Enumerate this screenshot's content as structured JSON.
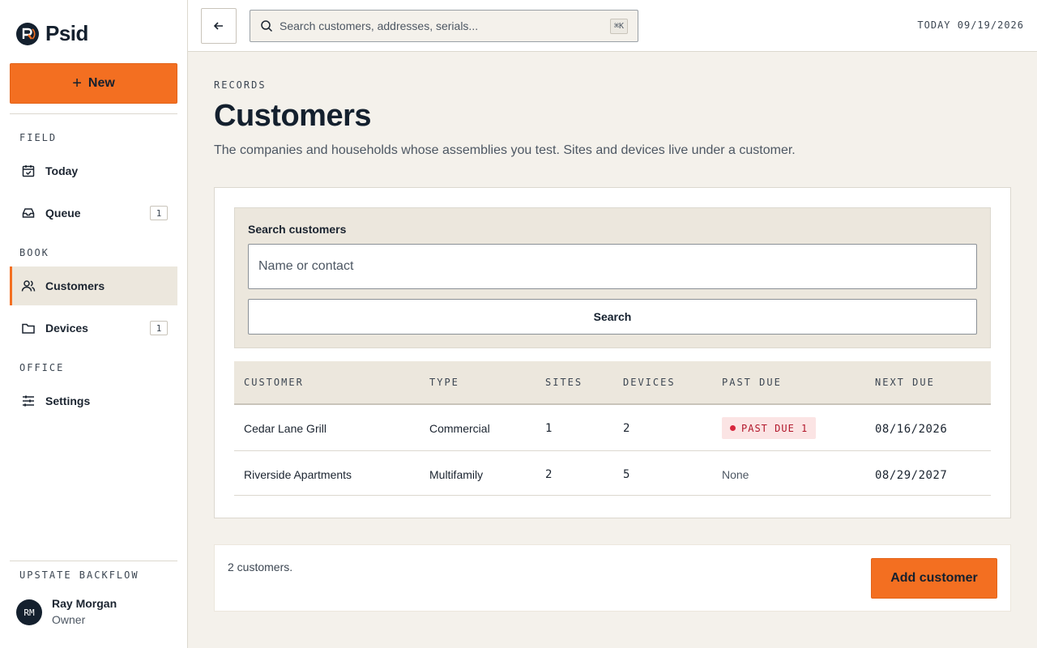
{
  "brand": {
    "name": "Psid",
    "logo_icon": "psid-logo-icon"
  },
  "sidebar": {
    "new_label": "New",
    "sections": {
      "field": "FIELD",
      "book": "BOOK",
      "office": "OFFICE"
    },
    "items": [
      {
        "label": "Today",
        "icon": "calendar-check-icon",
        "badge": null
      },
      {
        "label": "Queue",
        "icon": "inbox-icon",
        "badge": "1"
      },
      {
        "label": "Customers",
        "icon": "users-icon",
        "badge": null,
        "active": true
      },
      {
        "label": "Devices",
        "icon": "folder-icon",
        "badge": "1"
      },
      {
        "label": "Settings",
        "icon": "sliders-icon",
        "badge": null
      }
    ],
    "org": "UPSTATE BACKFLOW",
    "user": {
      "initials": "RM",
      "name": "Ray Morgan",
      "role": "Owner"
    }
  },
  "topbar": {
    "search_placeholder": "Search customers, addresses, serials...",
    "shortcut": "⌘K",
    "today": "TODAY 09/19/2026"
  },
  "main": {
    "eyebrow": "RECORDS",
    "title": "Customers",
    "subtitle": "The companies and households whose assemblies you test. Sites and devices live under a customer.",
    "search_panel": {
      "label": "Search customers",
      "placeholder": "Name or contact",
      "button": "Search"
    },
    "table": {
      "columns": [
        "CUSTOMER",
        "TYPE",
        "SITES",
        "DEVICES",
        "PAST DUE",
        "NEXT DUE"
      ],
      "rows": [
        {
          "customer": "Cedar Lane Grill",
          "type": "Commercial",
          "sites": "1",
          "devices": "2",
          "past_due": "PAST DUE 1",
          "past_due_flag": true,
          "next_due": "08/16/2026"
        },
        {
          "customer": "Riverside Apartments",
          "type": "Multifamily",
          "sites": "2",
          "devices": "5",
          "past_due": "None",
          "past_due_flag": false,
          "next_due": "08/29/2027"
        }
      ]
    },
    "footer": {
      "count": "2 customers.",
      "add_button": "Add customer"
    }
  },
  "colors": {
    "accent": "#f36f21",
    "navy": "#14202e",
    "past_due": "#b2172b",
    "background": "#f4f1eb"
  }
}
